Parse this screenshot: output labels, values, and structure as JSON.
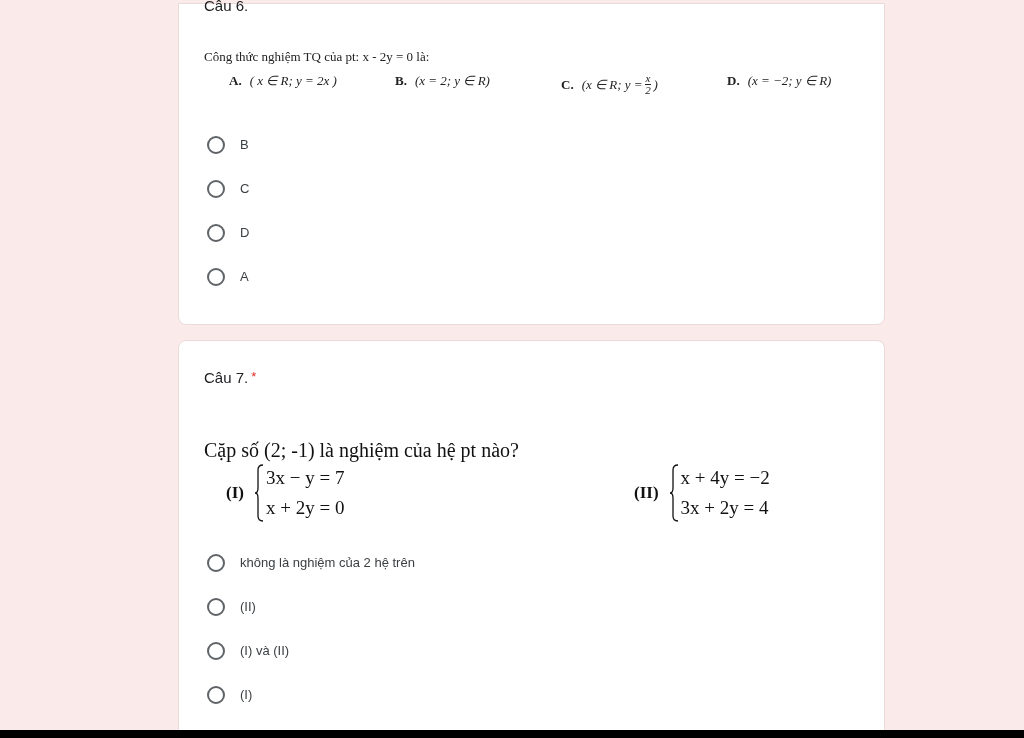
{
  "questions": [
    {
      "title": "Câu 6.",
      "kind": "options",
      "prompt": "Công thức nghiệm TQ của pt:  x - 2y = 0  là:",
      "choices": [
        {
          "letter": "A.",
          "before": "( x ∈ R; y = 2x )"
        },
        {
          "letter": "B.",
          "before": "(x = 2; y ∈ R)"
        },
        {
          "letter": "C.",
          "before": "(x ∈ R; y =",
          "numerator": "x",
          "denominator": "2",
          "after": ")"
        },
        {
          "letter": "D.",
          "before": "(x = −2; y ∈ R)"
        }
      ],
      "answers": [
        {
          "label": "B",
          "selected": false
        },
        {
          "label": "C",
          "selected": false
        },
        {
          "label": "D",
          "selected": false
        },
        {
          "label": "A",
          "selected": false
        }
      ]
    },
    {
      "title": "Câu 7.",
      "required_mark": "*",
      "kind": "systems",
      "prompt": "Cặp số (2; -1) là nghiệm của hệ pt nào?",
      "systems": [
        {
          "label": "(I)",
          "equations": [
            "3x − y = 7",
            "x + 2y = 0"
          ]
        },
        {
          "label": "(II)",
          "equations": [
            "x + 4y = −2",
            "3x + 2y = 4"
          ]
        }
      ],
      "answers": [
        {
          "label": "không là nghiệm của 2 hệ trên",
          "selected": false
        },
        {
          "label": "(II)",
          "selected": false
        },
        {
          "label": "(I) và (II)",
          "selected": false
        },
        {
          "label": "(I)",
          "selected": false
        }
      ]
    }
  ]
}
